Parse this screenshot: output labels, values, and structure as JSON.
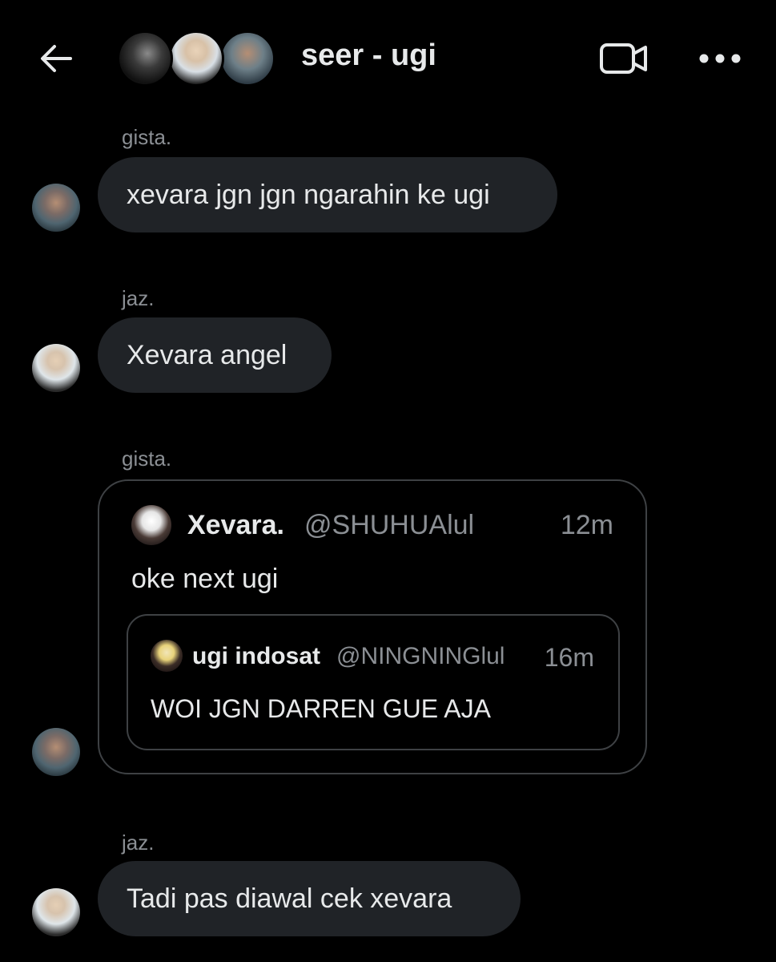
{
  "header": {
    "title": "seer - ugi",
    "back_icon": "arrow-left-icon",
    "video_icon": "video-camera-icon",
    "more_icon": "more-horizontal-icon"
  },
  "messages": [
    {
      "sender": "gista.",
      "text": "xevara jgn jgn ngarahin ke ugi"
    },
    {
      "sender": "jaz.",
      "text": "Xevara angel"
    },
    {
      "sender": "gista.",
      "quote": {
        "name": "Xevara.",
        "handle": "@SHUHUAlul",
        "time": "12m",
        "text": "oke next ugi",
        "inner": {
          "name": "ugi indosat",
          "handle": "@NINGNINGlul",
          "time": "16m",
          "text": "WOI JGN DARREN GUE AJA"
        }
      }
    },
    {
      "sender": "jaz.",
      "text": "Tadi pas diawal cek xevara"
    }
  ],
  "colors": {
    "background": "#000000",
    "bubble": "#202327",
    "text": "#e7e9ea",
    "muted": "#8b8f94",
    "border": "#3e4144"
  }
}
